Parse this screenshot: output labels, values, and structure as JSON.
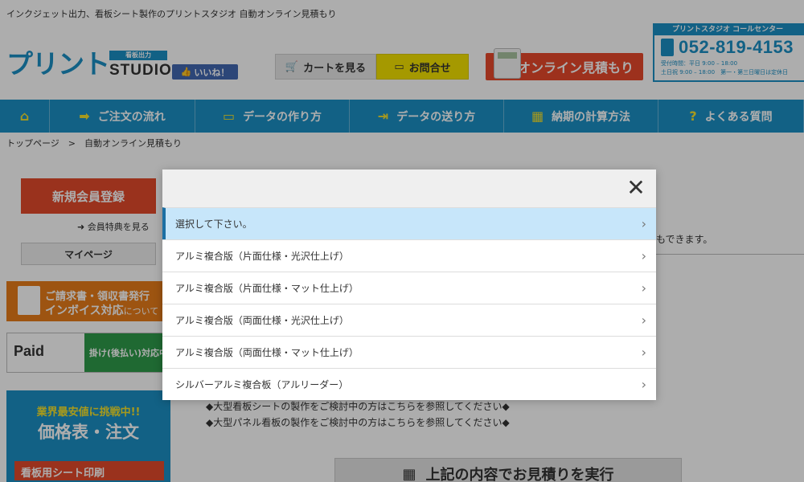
{
  "header": {
    "tagline": "インクジェット出力、看板シート製作のプリントスタジオ 自動オンライン見積もり",
    "logo": {
      "mark": "プリント",
      "sub": "看板出力",
      "studio": "STUDIO"
    },
    "like_label": "いいね！",
    "cart_label": "カートを見る",
    "contact_label": "お問合せ",
    "quote_label": "オンライン見積もり",
    "callcenter": {
      "title": "プリントスタジオ コールセンター",
      "number": "052-819-4153",
      "hours1": "受付時間：平日 9:00 – 18:00",
      "hours2": "土日祝 9:00 – 18:00　第一・第三日曜日は定休日"
    }
  },
  "nav": {
    "items": [
      {
        "label": "",
        "icon": "home-icon"
      },
      {
        "label": "ご注文の流れ",
        "icon": "arrow-icon"
      },
      {
        "label": "データの作り方",
        "icon": "monitor-icon"
      },
      {
        "label": "データの送り方",
        "icon": "send-icon"
      },
      {
        "label": "納期の計算方法",
        "icon": "calendar-icon"
      },
      {
        "label": "よくある質問",
        "icon": "question-icon"
      }
    ]
  },
  "breadcrumb": "トップページ　>　自動オンライン見積もり",
  "sidebar": {
    "register": "新規会員登録",
    "benefit": "会員特典を見る",
    "mypage": "マイページ",
    "invoice_line1": "ご請求書・領収書発行",
    "invoice_line2": "インボイス対応",
    "invoice_line2_suffix": "について",
    "paid_logo": "Paid",
    "paid_tag": "掛け(後払い)対応中",
    "price_line1": "業界最安値に挑戦中!!",
    "price_line2": "価格表・注文",
    "price_line3": "看板用シート印刷"
  },
  "main": {
    "partial_text": "もできます。",
    "notice1": "◆大型看板シートの製作をご検討中の方はこちらを参照してください◆",
    "notice2": "◆大型パネル看板の製作をご検討中の方はこちらを参照してください◆",
    "exec_label": "上記の内容でお見積りを実行"
  },
  "modal": {
    "close": "✕",
    "options": [
      {
        "label": "選択して下さい。",
        "selected": true
      },
      {
        "label": "アルミ複合版（片面仕様・光沢仕上げ）",
        "selected": false
      },
      {
        "label": "アルミ複合版（片面仕様・マット仕上げ）",
        "selected": false
      },
      {
        "label": "アルミ複合版（両面仕様・光沢仕上げ）",
        "selected": false
      },
      {
        "label": "アルミ複合版（両面仕様・マット仕上げ）",
        "selected": false
      },
      {
        "label": "シルバーアルミ複合板（アルリーダー）",
        "selected": false
      }
    ]
  },
  "colors": {
    "brand_blue": "#1b8fc4",
    "accent_red": "#e44a2b",
    "accent_yellow": "#f3e200",
    "selected_row": "#c7e6fa"
  }
}
